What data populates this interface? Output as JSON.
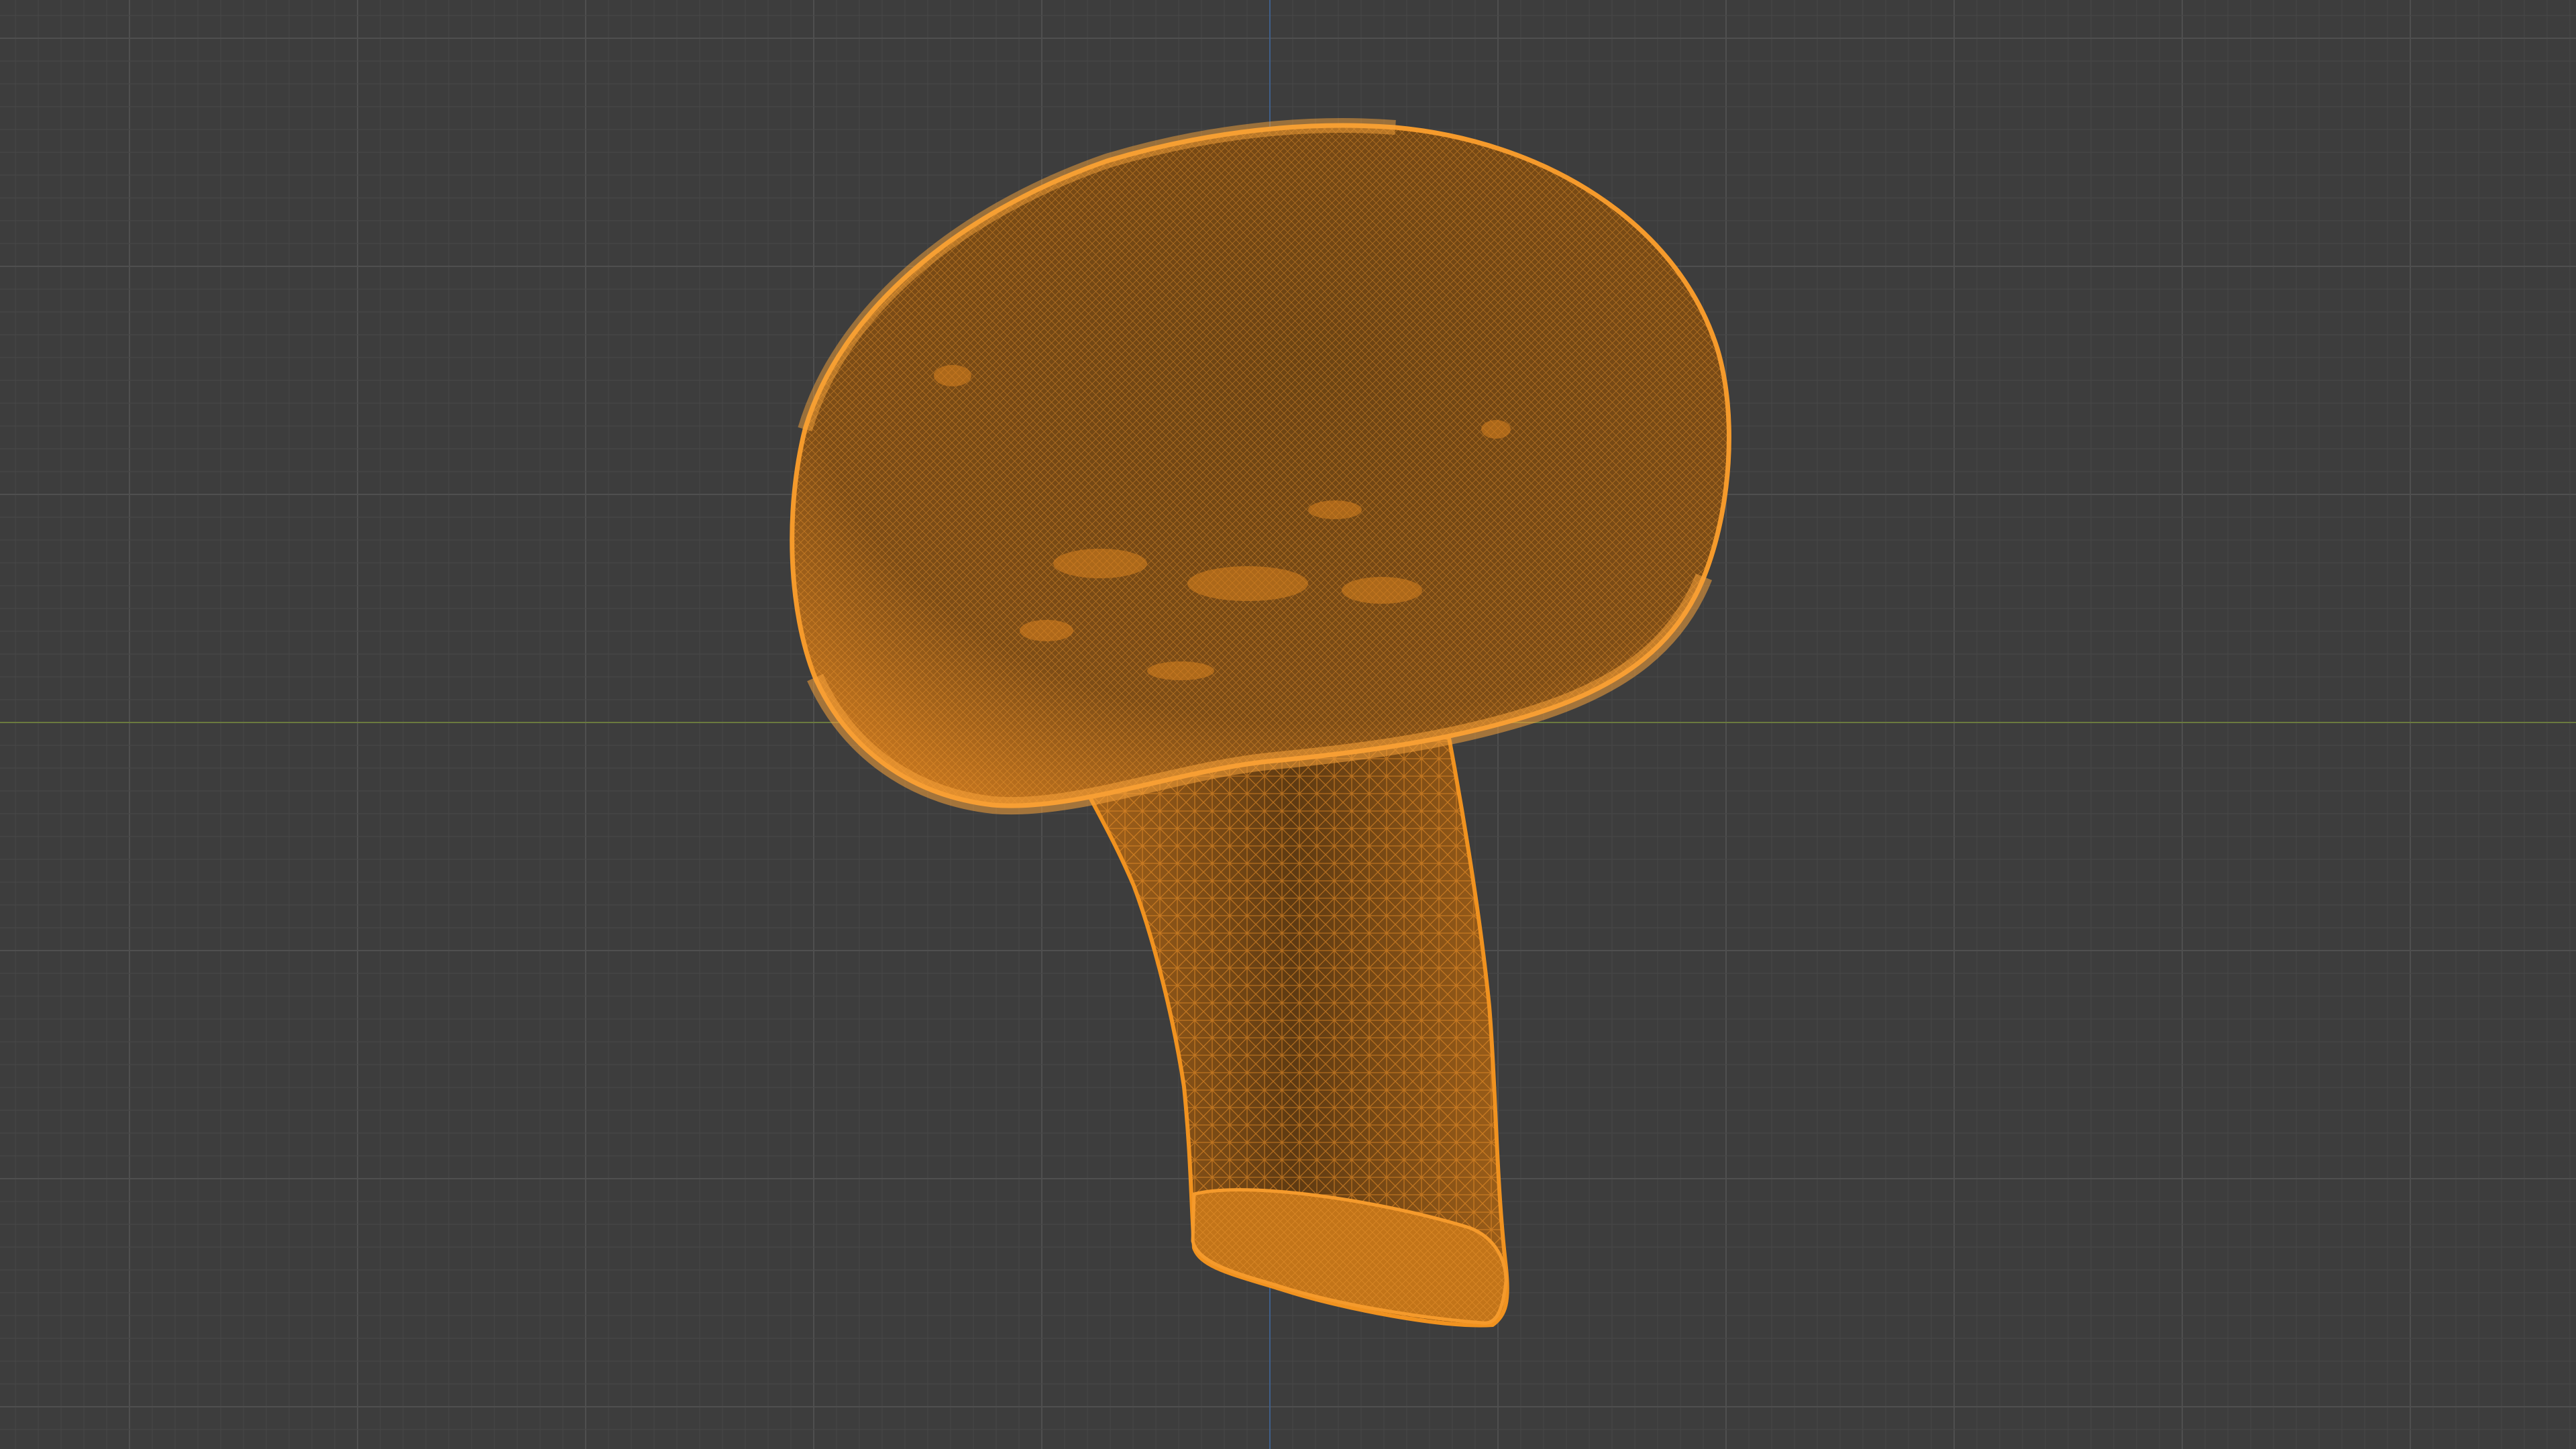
{
  "viewport": {
    "view_mode": "wireframe",
    "background_color": "#3d3d3d",
    "grid_minor_color": "#474747",
    "grid_major_color": "#4f4f4f",
    "x_axis_color": "#6b7a3f",
    "y_axis_color": "#3f5f8a"
  },
  "object": {
    "name": "mushroom-mesh",
    "selected": true,
    "wire_color": "#f0921f",
    "fill_color": "#7a4a14"
  }
}
